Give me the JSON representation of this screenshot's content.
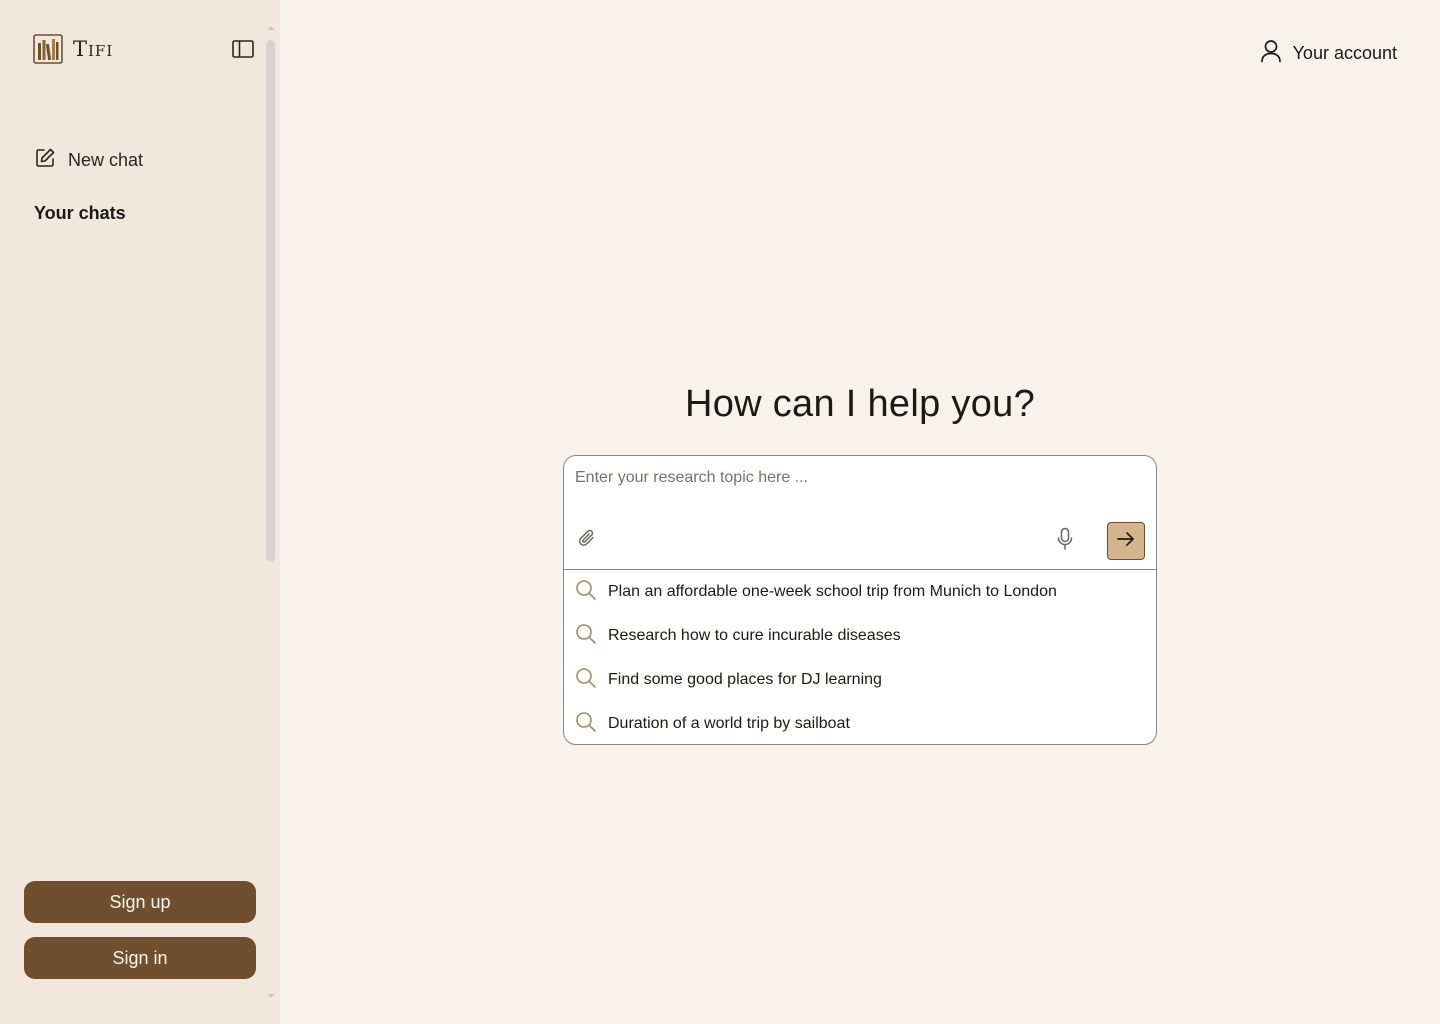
{
  "app": {
    "name": "Tifi",
    "logo_icon": "books-logo-icon"
  },
  "sidebar": {
    "toggle_icon": "sidebar-toggle-icon",
    "new_chat_label": "New chat",
    "new_chat_icon": "edit-icon",
    "section_title": "Your chats",
    "sign_up_label": "Sign up",
    "sign_in_label": "Sign in"
  },
  "header": {
    "account_label": "Your account",
    "account_icon": "user-icon"
  },
  "main": {
    "headline": "How can I help you?",
    "input": {
      "placeholder": "Enter your research topic here ...",
      "value": ""
    },
    "attach_icon": "paperclip-icon",
    "mic_icon": "microphone-icon",
    "send_icon": "arrow-right-icon",
    "suggestions": [
      {
        "label": "Plan an affordable one-week school trip from Munich to London",
        "icon": "search-icon"
      },
      {
        "label": "Research how to cure incurable diseases",
        "icon": "search-icon"
      },
      {
        "label": "Find some good places for DJ learning",
        "icon": "search-icon"
      },
      {
        "label": "Duration of a world trip by sailboat",
        "icon": "search-icon"
      }
    ]
  },
  "colors": {
    "sidebar_bg": "#f2e7dc",
    "main_bg": "#f7f2ec",
    "brand_brown": "#6f4f2d",
    "send_button_bg": "#d3b68f",
    "search_icon": "#a88a5c"
  }
}
